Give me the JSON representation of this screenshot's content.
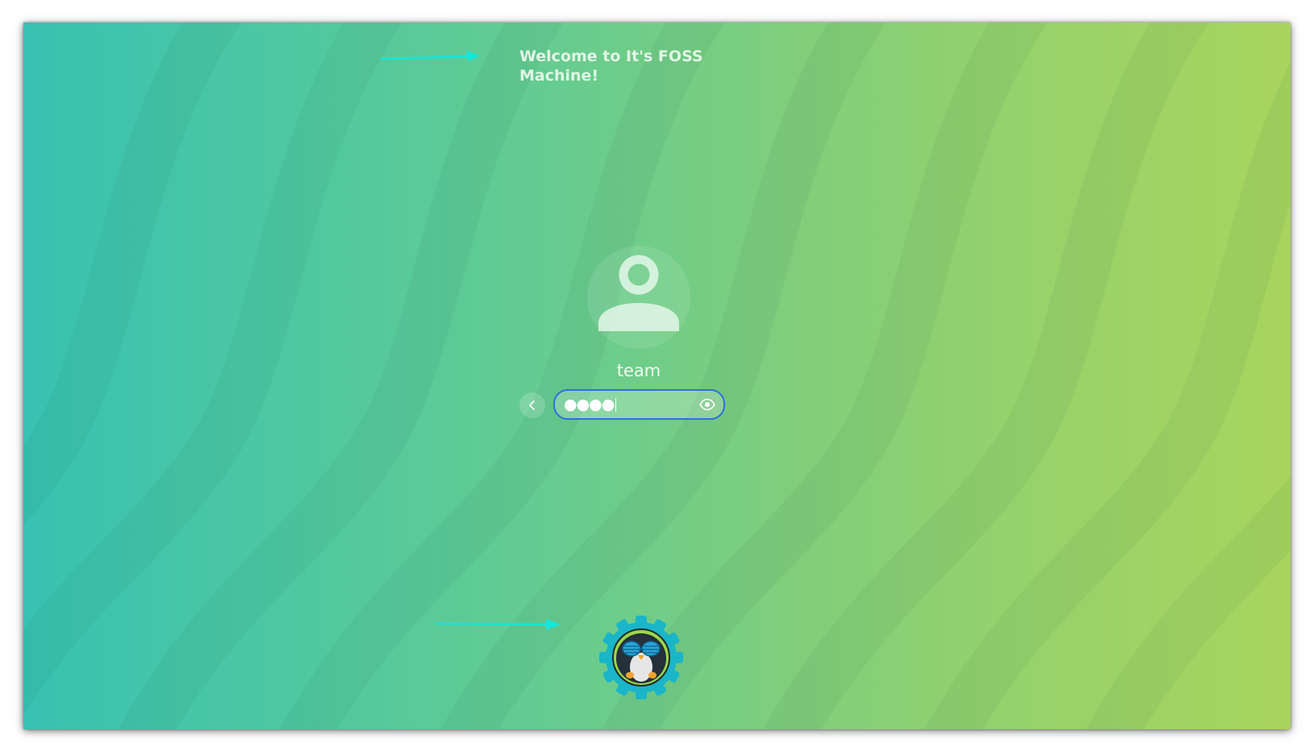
{
  "welcome": {
    "message": "Welcome to It's FOSS Machine!"
  },
  "user": {
    "avatar_icon": "user-avatar-icon",
    "name": "team"
  },
  "password": {
    "masked_value": "●●●●",
    "back_icon": "chevron-left-icon",
    "reveal_icon": "eye-icon",
    "focus_color": "#2f6ee5"
  },
  "branding": {
    "logo_icon": "tux-penguin-gear-logo"
  },
  "annotations": {
    "arrow_color": "#14e6dc"
  },
  "colors": {
    "background_start": "#38c2b2",
    "background_end": "#a8d45e"
  }
}
